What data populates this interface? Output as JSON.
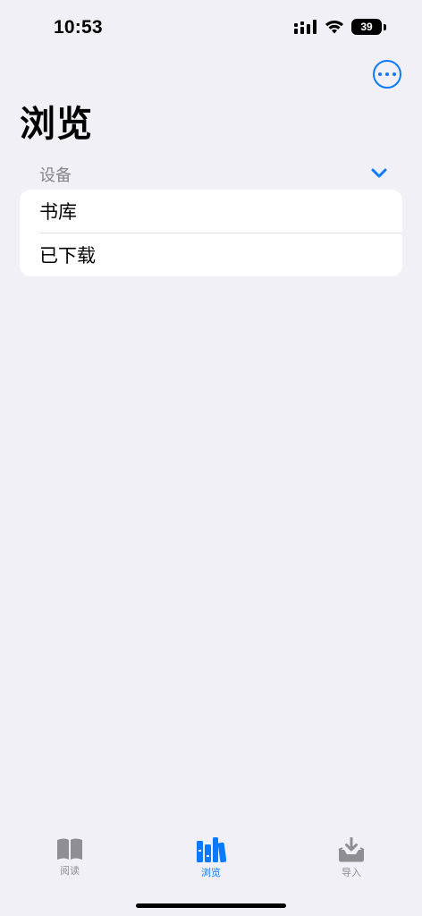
{
  "status_bar": {
    "time": "10:53",
    "battery": "39"
  },
  "header": {
    "title": "浏览",
    "more_icon": "ellipsis-circle-icon",
    "accent_color": "#0a7aff"
  },
  "section": {
    "label": "设备",
    "expanded": true,
    "items": [
      {
        "label": "书库"
      },
      {
        "label": "已下载"
      }
    ]
  },
  "tab_bar": {
    "tabs": [
      {
        "label": "阅读",
        "icon": "book-icon",
        "active": false
      },
      {
        "label": "浏览",
        "icon": "library-icon",
        "active": true
      },
      {
        "label": "导入",
        "icon": "tray-download-icon",
        "active": false
      }
    ]
  }
}
